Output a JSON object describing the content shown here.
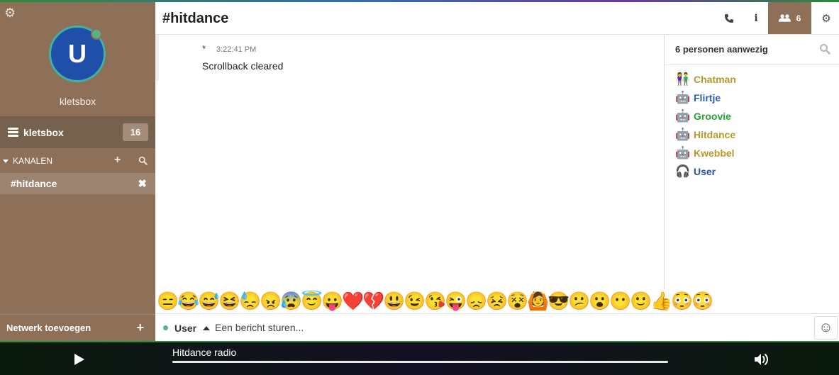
{
  "sidebar": {
    "avatar_letter": "U",
    "username": "kletsbox",
    "network": {
      "label": "kletsbox",
      "badge": "16"
    },
    "channels_header": "KANALEN",
    "channels": [
      {
        "label": "#hitdance"
      }
    ],
    "add_network_label": "Netwerk toevoegen",
    "icons": [
      "gear-icon",
      "server-icon",
      "plus-icon",
      "search-icon",
      "close-icon"
    ]
  },
  "header": {
    "title": "#hitdance",
    "user_count": "6"
  },
  "messages": [
    {
      "nick": "*",
      "time": "3:22:41 PM",
      "text": "Scrollback cleared"
    }
  ],
  "nicklist": {
    "title": "6 personen aanwezig",
    "users": [
      {
        "name": "Chatman",
        "color": "#b79a2a",
        "icon": "couple-icon"
      },
      {
        "name": "Flirtje",
        "color": "#2a62b7",
        "icon": "robot-icon"
      },
      {
        "name": "Groovie",
        "color": "#2aa03a",
        "icon": "robot-icon"
      },
      {
        "name": "Hitdance",
        "color": "#b79a2a",
        "icon": "robot-icon"
      },
      {
        "name": "Kwebbel",
        "color": "#b79a2a",
        "icon": "robot-icon"
      },
      {
        "name": "User",
        "color": "#2a52a8",
        "icon": "headphones-icon"
      }
    ]
  },
  "emojis": [
    "😑",
    "😂",
    "😅",
    "😆",
    "😓",
    "😠",
    "😰",
    "😇",
    "😛",
    "❤️",
    "💔",
    "😃",
    "😉",
    "😘",
    "😜",
    "😞",
    "😣",
    "😵",
    "🙆",
    "😎",
    "😕",
    "😮",
    "😶",
    "🙂",
    "👍",
    "😳",
    "😳"
  ],
  "input": {
    "nick": "User",
    "placeholder": "Een bericht sturen..."
  },
  "player": {
    "title": "Hitdance radio",
    "progress": 1.0
  },
  "colors": {
    "sidebar": "#8e7058",
    "accent": "#3fb3a0",
    "avatar": "#1f4fa8"
  }
}
